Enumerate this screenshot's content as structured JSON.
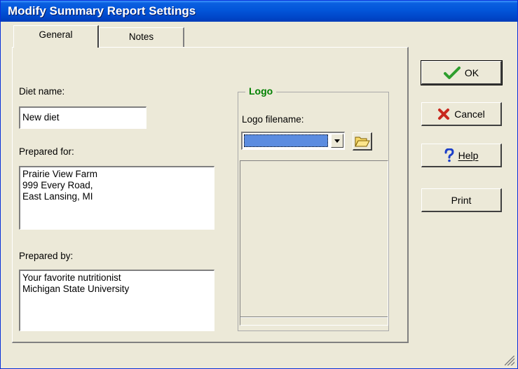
{
  "window": {
    "title": "Modify Summary Report Settings"
  },
  "tabs": [
    {
      "label": "General",
      "active": true
    },
    {
      "label": "Notes",
      "active": false
    }
  ],
  "general": {
    "diet_name_label": "Diet name:",
    "diet_name_value": "New diet",
    "prepared_for_label": "Prepared for:",
    "prepared_for_lines": [
      "Prairie View Farm",
      "999 Every Road,",
      "East Lansing, MI"
    ],
    "prepared_by_label": "Prepared by:",
    "prepared_by_lines": [
      "Your favorite nutritionist",
      "Michigan State University"
    ]
  },
  "logo": {
    "group_label": "Logo",
    "filename_label": "Logo filename:",
    "filename_value": "",
    "legend_color": "#008000"
  },
  "buttons": {
    "ok": {
      "label": "OK",
      "icon": "check-icon"
    },
    "cancel": {
      "label": "Cancel",
      "icon": "x-icon"
    },
    "help": {
      "label": "Help",
      "icon": "question-icon"
    },
    "print": {
      "label": "Print"
    }
  },
  "colors": {
    "titlebar": "#0255d9",
    "dialog_bg": "#ece9d8",
    "ok_check": "#2e9e2e",
    "cancel_x": "#c8281e",
    "help_q": "#1c3fc8"
  }
}
